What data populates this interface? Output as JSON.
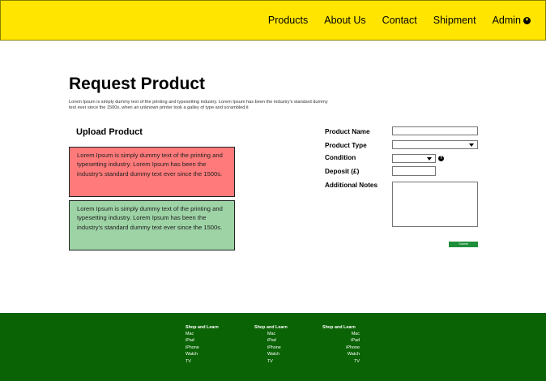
{
  "nav": {
    "products": "Products",
    "about": "About Us",
    "contact": "Contact",
    "shipment": "Shipment",
    "admin": "Admin",
    "admin_icon": "chevron-down-circle-icon"
  },
  "header": {
    "title": "Request Product",
    "description": "Lorem Ipsum is simply dummy text of the printing and typesetting industry. Lorem Ipsum has been the industry's standard dummy text ever since the 1500s, when an unknown printer took a galley of type and scrambled it"
  },
  "upload": {
    "title": "Upload Product",
    "card_red": "Lorem Ipsum is simply dummy text of the printing and typesetting industry. Lorem Ipsum has been the industry's standard dummy text ever since the 1500s.",
    "card_green": "Lorem Ipsum is simply dummy text of the printing and typesetting industry. Lorem Ipsum has been the industry's standard dummy text ever since the 1500s."
  },
  "form": {
    "product_name_label": "Product Name",
    "product_name_value": "",
    "product_type_label": "Product Type",
    "product_type_value": "",
    "condition_label": "Condition",
    "condition_value": "",
    "deposit_label": "Deposit (£)",
    "deposit_value": "",
    "notes_label": "Additional Notes",
    "notes_value": "",
    "help_icon": "question-circle-icon",
    "submit_label": "Submit"
  },
  "footer": {
    "columns": [
      {
        "heading": "Shop and Learn",
        "links": [
          "Mac",
          "iPad",
          "iPhone",
          "Watch",
          "TV"
        ]
      },
      {
        "heading": "Shop and Learn",
        "links": [
          "Mac",
          "iPad",
          "iPhone",
          "Watch",
          "TV"
        ]
      },
      {
        "heading": "Shop and Learn",
        "links": [
          "Mac",
          "iPad",
          "iPhone",
          "Watch",
          "TV"
        ]
      }
    ]
  },
  "colors": {
    "header_bg": "#ffe500",
    "footer_bg": "#0a6304",
    "card_red": "#ff7a7a",
    "card_green": "#9dd3a5",
    "submit_bg": "#1e8f3a"
  }
}
